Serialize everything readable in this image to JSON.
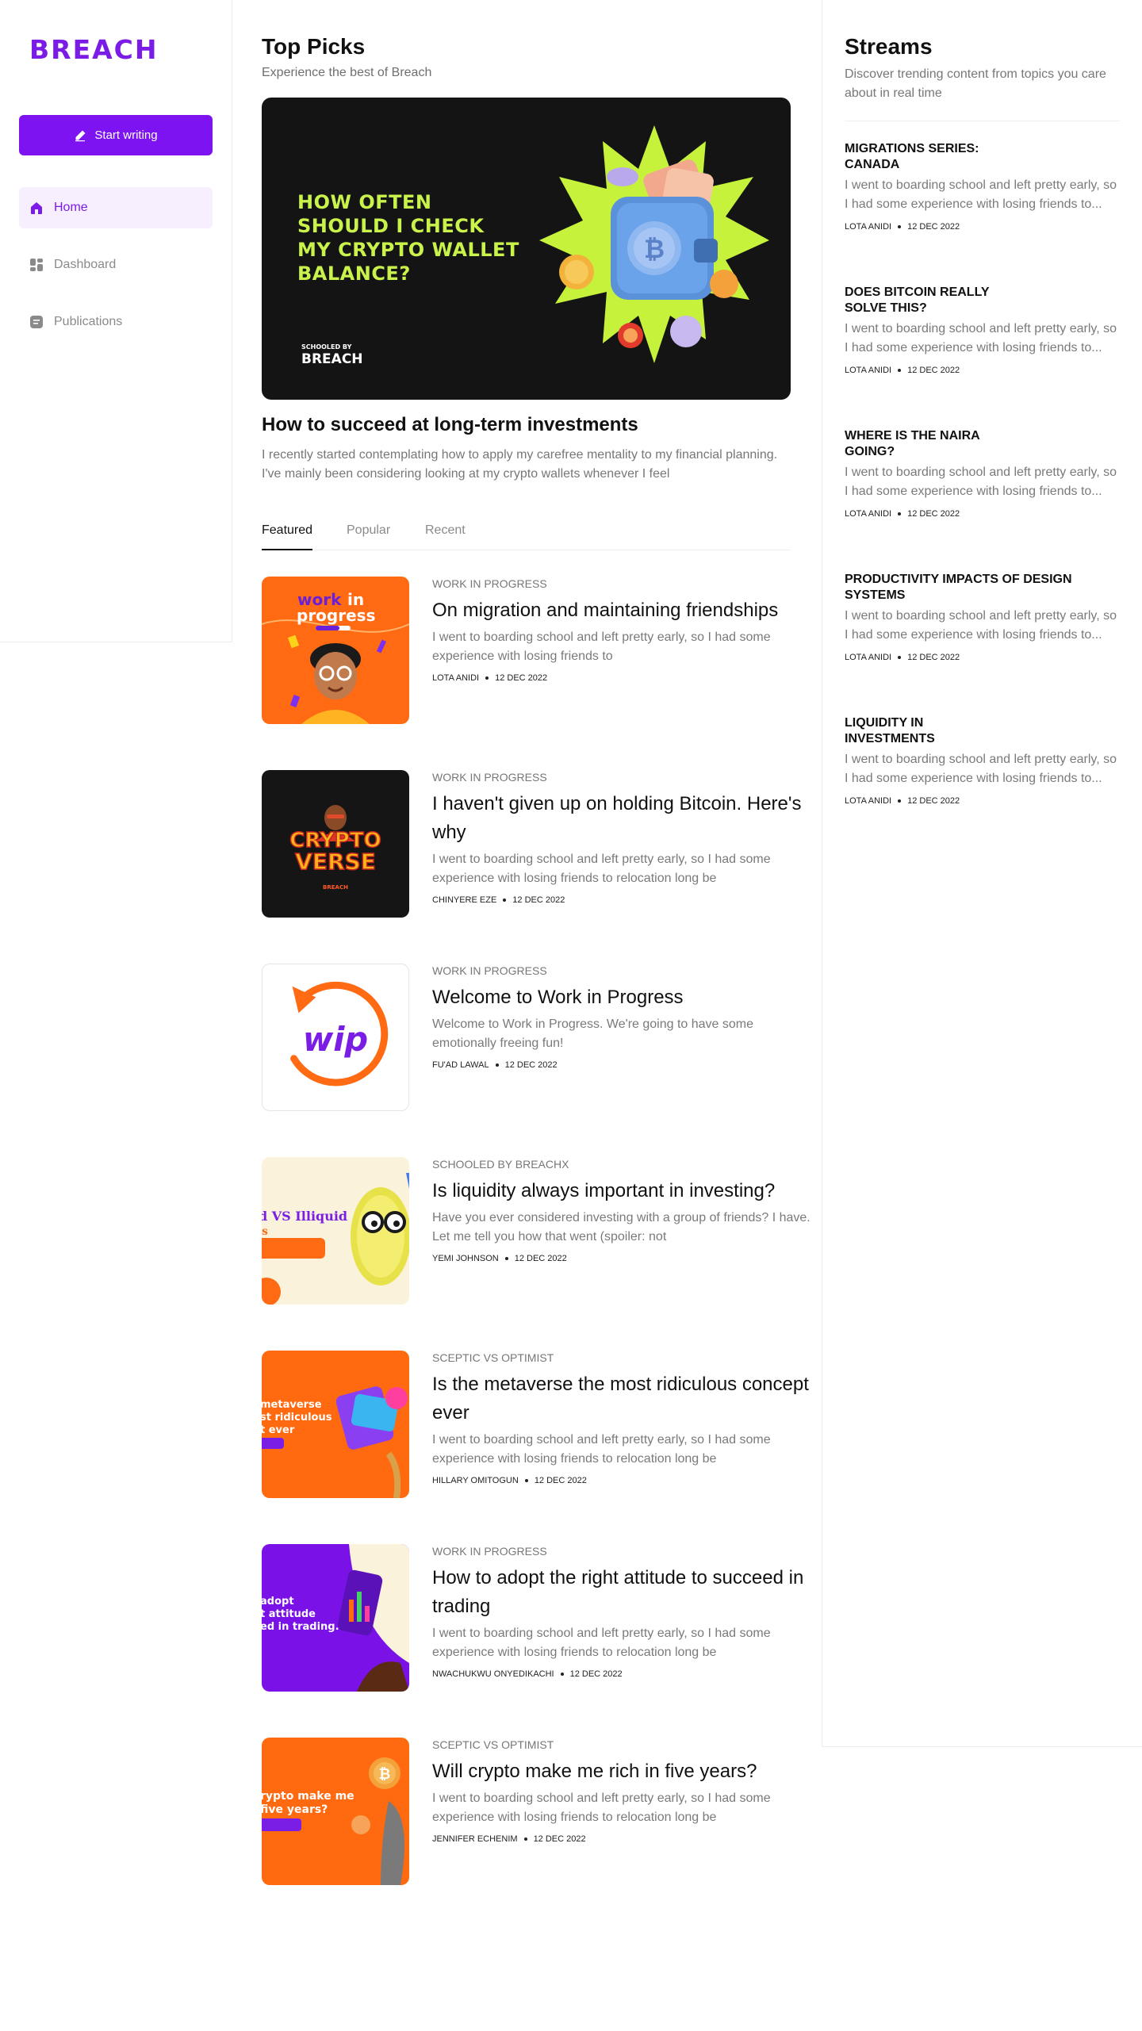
{
  "brand": {
    "logo": "BREACH",
    "accent": "#7d13f0"
  },
  "sidebar": {
    "write_button": "Start writing",
    "items": [
      {
        "label": "Home",
        "icon": "home-icon",
        "active": true
      },
      {
        "label": "Dashboard",
        "icon": "dashboard-icon",
        "active": false
      },
      {
        "label": "Publications",
        "icon": "publications-icon",
        "active": false
      }
    ]
  },
  "main": {
    "title": "Top Picks",
    "subtitle": "Experience the best of Breach",
    "hero": {
      "headline": "HOW OFTEN\nSHOULD I CHECK\nMY CRYPTO WALLET\nBALANCE?",
      "badge_top": "SCHOOLED BY",
      "badge_brand": "BREACH"
    },
    "featured_title": "How to succeed at long-term investments",
    "featured_excerpt": "I recently started contemplating how to apply my carefree mentality to my financial planning. I've mainly been considering looking at my crypto wallets whenever I feel",
    "tabs": [
      "Featured",
      "Popular",
      "Recent"
    ],
    "articles": [
      {
        "category": "WORK IN PROGRESS",
        "title": "On migration and maintaining friendships",
        "excerpt": "I went to boarding school and left pretty early, so I had some experience with losing friends to",
        "author": "LOTA ANIDI",
        "date": "12 DEC 2022",
        "thumb_text": "work in progress"
      },
      {
        "category": "WORK IN PROGRESS",
        "title": "I haven't given up on holding Bitcoin. Here's why",
        "excerpt": "I went to boarding school and left pretty early, so I had some experience with losing friends to relocation long be",
        "author": "CHINYERE EZE",
        "date": "12 DEC 2022",
        "thumb_text": "CRYPTO VERSE"
      },
      {
        "category": "WORK IN PROGRESS",
        "title": "Welcome to Work in Progress",
        "excerpt": "Welcome to Work in Progress. We're going to have some emotionally freeing fun!",
        "author": "FU'AD LAWAL",
        "date": "12 DEC 2022",
        "thumb_text": "wip"
      },
      {
        "category": "SCHOOLED BY BREACHX",
        "title": "Is liquidity always important in investing?",
        "excerpt": "Have you ever considered investing with a group of friends? I have. Let me tell you how that went (spoiler: not",
        "author": "YEMI JOHNSON",
        "date": "12 DEC 2022",
        "thumb_text": "d VS Illiquid"
      },
      {
        "category": "SCEPTIC VS OPTIMIST",
        "title": "Is the metaverse the most ridiculous concept ever",
        "excerpt": "I went to boarding school and left pretty early, so I had some experience with losing friends to relocation long be",
        "author": "HILLARY OMITOGUN",
        "date": "12 DEC 2022",
        "thumb_text": "metaverse st ridiculous t ever"
      },
      {
        "category": "WORK IN PROGRESS",
        "title": "How to adopt the right attitude to succeed in trading",
        "excerpt": "I went to boarding school and left pretty early, so I had some experience with losing friends to relocation long be",
        "author": "NWACHUKWU ONYEDIKACHI",
        "date": "12 DEC 2022",
        "thumb_text": "adopt t attitude ed in trading."
      },
      {
        "category": "SCEPTIC VS OPTIMIST",
        "title": "Will crypto make me rich in five years?",
        "excerpt": "I went to boarding school and left pretty early, so I had some experience with losing friends to relocation long be",
        "author": "JENNIFER ECHENIM",
        "date": "12 DEC 2022",
        "thumb_text": "rypto make me five years?"
      }
    ]
  },
  "streams": {
    "title": "Streams",
    "subtitle": "Discover trending content from topics you care about in real time",
    "items": [
      {
        "title": "MIGRATIONS SERIES: CANADA",
        "excerpt": "I went to boarding school and left pretty early, so I had some experience with losing friends to...",
        "author": "LOTA ANIDI",
        "date": "12 DEC 2022"
      },
      {
        "title": "DOES BITCOIN REALLY SOLVE THIS?",
        "excerpt": "I went to boarding school and left pretty early, so I had some experience with losing friends to...",
        "author": "LOTA ANIDI",
        "date": "12 DEC 2022"
      },
      {
        "title": "WHERE IS THE NAIRA GOING?",
        "excerpt": "I went to boarding school and left pretty early, so I had some experience with losing friends to...",
        "author": "LOTA ANIDI",
        "date": "12 DEC 2022"
      },
      {
        "title": "PRODUCTIVITY IMPACTS OF DESIGN SYSTEMS",
        "excerpt": "I went to boarding school and left pretty early, so I had some experience with losing friends to...",
        "author": "LOTA ANIDI",
        "date": "12 DEC 2022"
      },
      {
        "title": "LIQUIDITY IN INVESTMENTS",
        "excerpt": "I went to boarding school and left pretty early, so I had some experience with losing friends to...",
        "author": "LOTA ANIDI",
        "date": "12 DEC 2022"
      }
    ]
  }
}
